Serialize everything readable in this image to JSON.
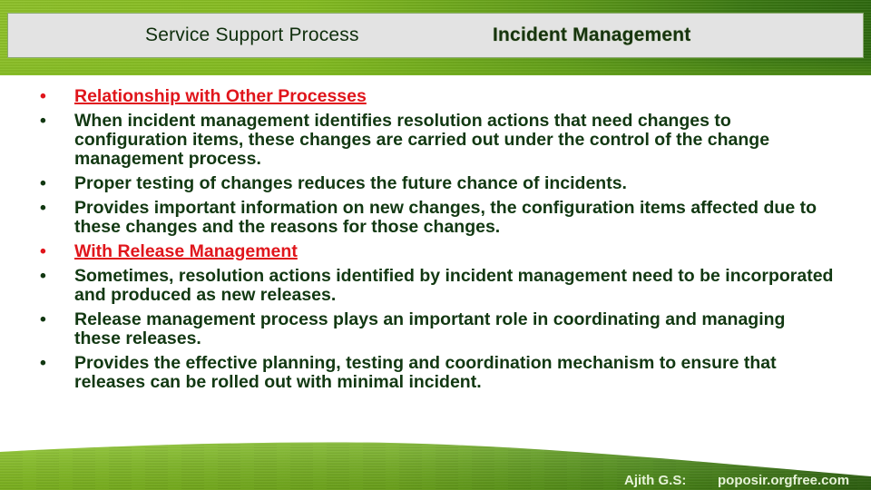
{
  "header": {
    "left_title": "Service Support Process",
    "right_title": "Incident Management"
  },
  "bullets": [
    {
      "text": "Relationship with Other Processes",
      "style": "heading"
    },
    {
      "text": "When incident management identifies resolution actions that need changes to configuration items, these changes are carried out under the control of the change management process.",
      "style": "body"
    },
    {
      "text": "Proper testing of changes reduces the future chance of incidents.",
      "style": "body"
    },
    {
      "text": "Provides important information on new changes, the configuration items affected due to these changes and the reasons for those changes.",
      "style": "body"
    },
    {
      "text": "With Release Management",
      "style": "heading"
    },
    {
      "text": "Sometimes, resolution actions identified by incident management need to be incorporated and produced as new releases.",
      "style": "body"
    },
    {
      "text": "Release management process plays an important role in coordinating and managing these releases.",
      "style": "body"
    },
    {
      "text": "Provides the effective planning, testing and coordination mechanism to ensure that releases can be rolled out with minimal incident.",
      "style": "body"
    }
  ],
  "bullet_glyph": "•",
  "footer": {
    "author": "Ajith G.S:",
    "site": "poposir.orgfree.com"
  },
  "colors": {
    "heading_red": "#e0151b",
    "body_green": "#123812",
    "title_box_gray": "#e3e3e3",
    "grass_green": "#7cb622"
  }
}
